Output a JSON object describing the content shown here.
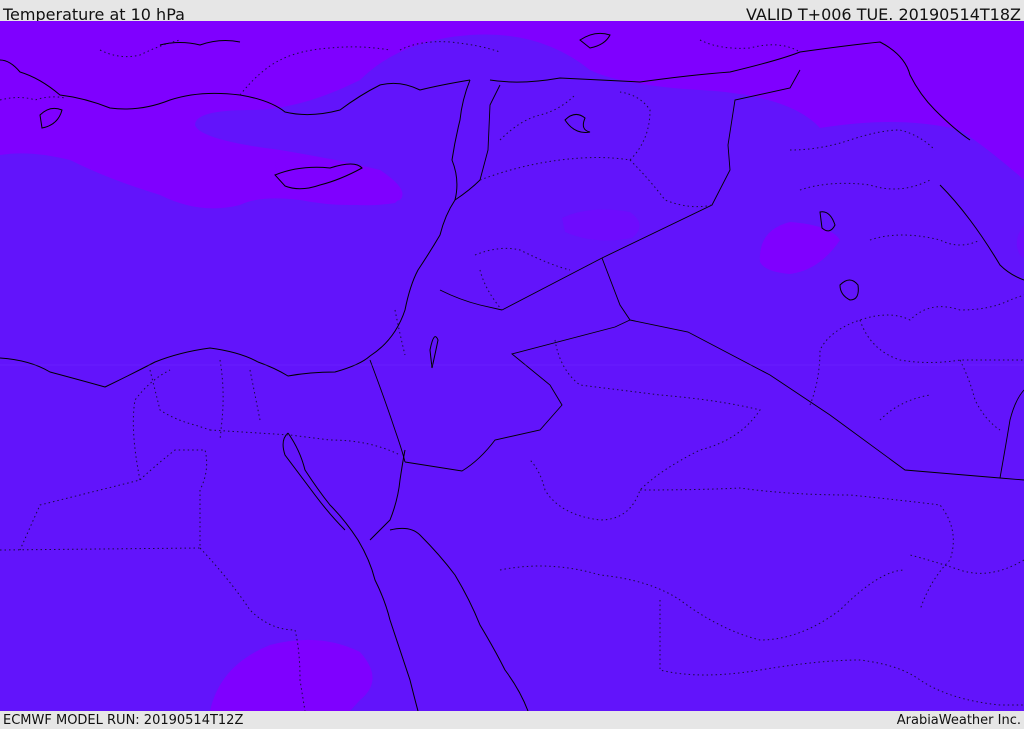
{
  "header": {
    "title": "Temperature at 10 hPa",
    "valid_time": "VALID T+006 TUE. 20190514T18Z"
  },
  "footer": {
    "model_run": "ECMWF MODEL RUN: 20190514T12Z",
    "credit": "ArabiaWeather Inc."
  },
  "colors": {
    "field_base": "#6214fb",
    "field_cold": "#7f00ff",
    "field_mid": "#6e0bfd",
    "coastline": "#000000",
    "border_dotted": "#1a0a40"
  },
  "layers": [
    "temperature-field",
    "coastlines",
    "country-borders",
    "province-borders"
  ]
}
